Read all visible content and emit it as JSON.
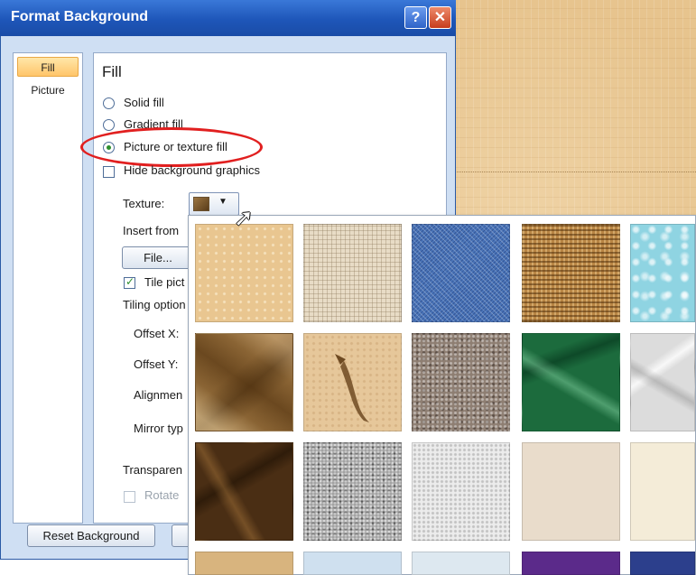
{
  "dialog": {
    "title": "Format Background",
    "help_label": "?",
    "close_label": "✕"
  },
  "nav": {
    "items": [
      {
        "label": "Fill",
        "selected": true
      },
      {
        "label": "Picture",
        "selected": false
      }
    ]
  },
  "fill": {
    "heading": "Fill",
    "options": [
      {
        "label": "Solid fill",
        "selected": false
      },
      {
        "label": "Gradient fill",
        "selected": false
      },
      {
        "label": "Picture or texture fill",
        "selected": true
      }
    ],
    "hide_background_graphics": {
      "label": "Hide background graphics",
      "checked": false
    },
    "texture_label": "Texture:",
    "insert_from_label": "Insert from",
    "file_button": "File...",
    "tile_picture": {
      "label": "Tile pict",
      "checked": true
    },
    "tiling_options_label": "Tiling option",
    "offset_x_label": "Offset X:",
    "offset_y_label": "Offset Y:",
    "alignment_label": "Alignmen",
    "mirror_type_label": "Mirror typ",
    "transparency_label": "Transparen",
    "rotate_label": "Rotate",
    "rotate_checked": false
  },
  "footer": {
    "reset_button": "Reset Background"
  },
  "gallery": {
    "icon": "texture-swatch-icon",
    "textures": [
      "sand",
      "burlap",
      "denim",
      "woven-mat",
      "water-droplets",
      "paper-bag",
      "fish-fossil",
      "granite",
      "green-marble",
      "white-marble",
      "brown-marble",
      "gray-granite",
      "white-granite",
      "parchment",
      "cream"
    ]
  },
  "colors": {
    "title_bar": "#1e56b9",
    "highlight": "#e11f1f",
    "slide_texture": "#e7c48e"
  }
}
